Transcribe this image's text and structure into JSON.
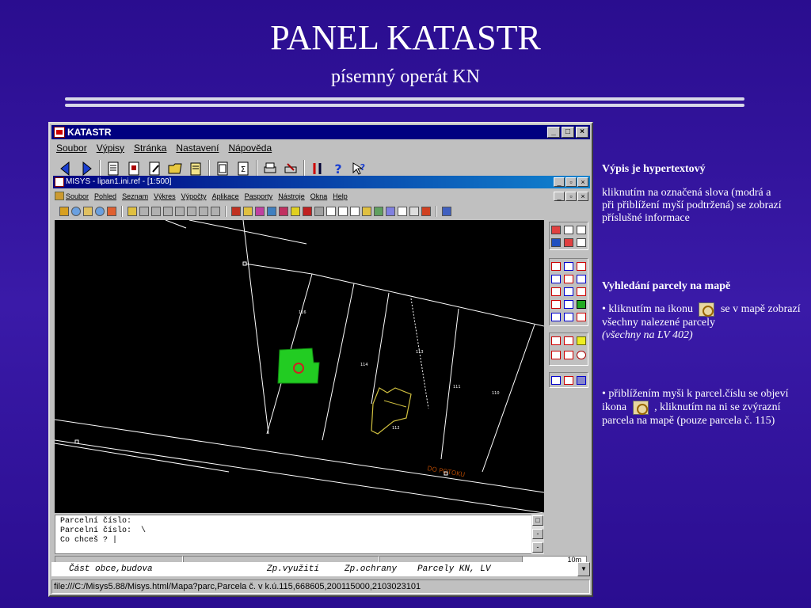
{
  "slide": {
    "title": "PANEL KATASTR",
    "subtitle": "písemný operát KN"
  },
  "window": {
    "title": "KATASTR",
    "menu": [
      "Soubor",
      "Výpisy",
      "Stránka",
      "Nastavení",
      "Nápověda"
    ],
    "min": "_",
    "max": "□",
    "close": "×"
  },
  "inner_window": {
    "title": "MISYS - lipan1.ini.ref - [1:500]",
    "menu": [
      "Soubor",
      "Pohled",
      "Seznam",
      "Výkres",
      "Výpočty",
      "Aplikace",
      "Pasporty",
      "Nástroje",
      "Okna",
      "Help"
    ],
    "min": "_",
    "restore": "▫",
    "close": "×"
  },
  "map": {
    "parcel_labels": [
      "116",
      "114",
      "113",
      "111",
      "110",
      "112"
    ],
    "road_label": "DO POTOKU"
  },
  "command_area": {
    "lines": [
      "Parcelní číslo:",
      "Parcelní číslo:  \\",
      "Co chceš ? |"
    ]
  },
  "scale": "10m",
  "fields": {
    "c1": "Část obce,budova",
    "c2": "Zp.využití",
    "c3": "Zp.ochrany",
    "c4": "Parcely KN, LV"
  },
  "url": "file:///C:/Misys5.88/Misys.html/Mapa?parc,Parcela č. v k.ú.115,668605,200115000,2103023101",
  "notes": {
    "n1_heading": "Výpis je hypertextový",
    "n1_body": "kliknutím na označená slova (modrá a při přiblížení myší podtržená) se zobrazí příslušné informace",
    "n2_heading": "Vyhledání parcely na mapě",
    "n2_a": "• kliknutím na ikonu",
    "n2_b": "se v mapě zobrazí všechny nalezené parcely",
    "n2_c": "(všechny na LV 402)",
    "n3_a": "• přiblížením myši k parcel.číslu se objeví ikona",
    "n3_b": ", kliknutím na ni se zvýrazní parcela na mapě (pouze parcela č. 115)"
  }
}
